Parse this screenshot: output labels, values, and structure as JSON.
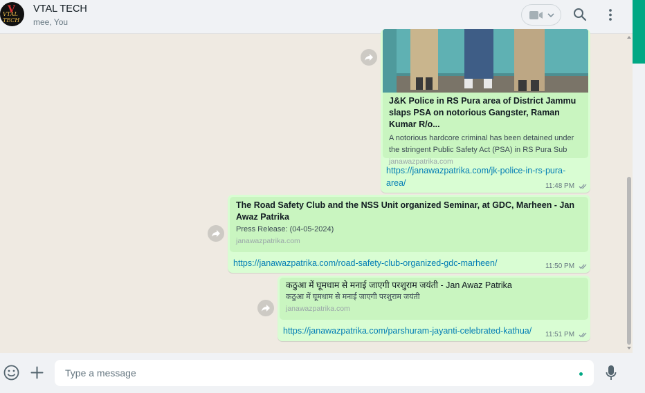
{
  "header": {
    "chat_name": "VTAL TECH",
    "participants": "mee, You",
    "avatar_text": "VTAL TECH",
    "avatar_v": "V",
    "icons": [
      "video-call-icon",
      "chevron-down-icon",
      "search-icon",
      "menu-icon"
    ]
  },
  "messages": [
    {
      "preview_title": "J&K Police in RS Pura area of District Jammu slaps PSA on notorious Gangster, Raman Kumar R/o...",
      "preview_desc": "A notorious hardcore criminal has been detained under the stringent Public Safety Act (PSA) in RS Pura Sub",
      "domain": "janawazpatrika.com",
      "link": "https://janawazpatrika.com/jk-police-in-rs-pura-area/",
      "time": "11:48 PM"
    },
    {
      "preview_title": "The Road Safety Club and the NSS Unit organized Seminar, at GDC, Marheen - Jan Awaz Patrika",
      "preview_desc": "Press Release: (04-05-2024)",
      "domain": "janawazpatrika.com",
      "link": "https://janawazpatrika.com/road-safety-club-organized-gdc-marheen/",
      "time": "11:50 PM"
    },
    {
      "preview_title": "कठुआ में घूमधाम से मनाई जाएगी परशुराम जयंती - Jan Awaz Patrika",
      "preview_desc": "कठुआ में घूमधाम से मनाई जाएगी परशुराम जयंती",
      "domain": "janawazpatrika.com",
      "link": "https://janawazpatrika.com/parshuram-jayanti-celebrated-kathua/",
      "time": "11:51 PM"
    }
  ],
  "composer": {
    "placeholder": "Type a message"
  },
  "colors": {
    "bubble": "#d9fdd3",
    "link": "#027eb5",
    "accent": "#00a884",
    "background": "#efeae2"
  }
}
